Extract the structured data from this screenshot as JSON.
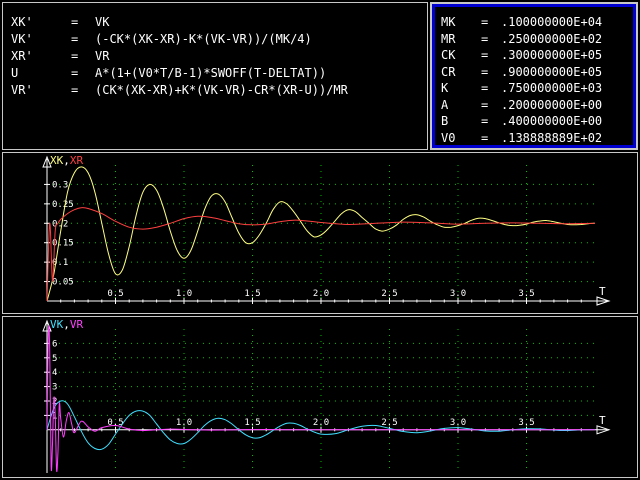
{
  "equations": [
    {
      "lhs": "XK'",
      "sep": "=",
      "rhs": "VK"
    },
    {
      "lhs": "VK'",
      "sep": "=",
      "rhs": "(-CK*(XK-XR)-K*(VK-VR))/(MK/4)"
    },
    {
      "lhs": "XR'",
      "sep": "=",
      "rhs": "VR"
    },
    {
      "lhs": "U",
      "sep": "=",
      "rhs": "A*(1+(V0*T/B-1)*SWOFF(T-DELTAT))"
    },
    {
      "lhs": "VR'",
      "sep": "=",
      "rhs": "(CK*(XK-XR)+K*(VK-VR)-CR*(XR-U))/MR"
    }
  ],
  "parameters": [
    {
      "name": "MK",
      "sep": "=",
      "value": ".100000000E+04"
    },
    {
      "name": "MR",
      "sep": "=",
      "value": ".250000000E+02"
    },
    {
      "name": "CK",
      "sep": "=",
      "value": ".300000000E+05"
    },
    {
      "name": "CR",
      "sep": "=",
      "value": ".900000000E+05"
    },
    {
      "name": "K",
      "sep": "=",
      "value": ".750000000E+03"
    },
    {
      "name": "A",
      "sep": "=",
      "value": ".200000000E+00"
    },
    {
      "name": "B",
      "sep": "=",
      "value": ".400000000E+00"
    },
    {
      "name": "V0",
      "sep": "=",
      "value": ".138888889E+02"
    }
  ],
  "colors": {
    "background": "#000000",
    "border": "#c8c8c8",
    "params_frame": "#0000d0",
    "axes": "#ffffff",
    "grid": "#00c000",
    "xk": "#ffff80",
    "xr": "#ff4040",
    "vk": "#40e0ff",
    "vr": "#ff40ff"
  },
  "chart_data": [
    {
      "type": "line",
      "legend_prefix": "XK",
      "legend_sep": ",",
      "legend_second": "XR",
      "xlabel": "T",
      "xlim": [
        0,
        4.0
      ],
      "ylim": [
        0,
        0.35
      ],
      "x_ticks": [
        "0.5",
        "1.0",
        "1.5",
        "2.0",
        "2.5",
        "3.0",
        "3.5"
      ],
      "x_tick_values": [
        0.5,
        1.0,
        1.5,
        2.0,
        2.5,
        3.0,
        3.5
      ],
      "y_ticks": [
        "0.05",
        "0.1",
        "0.15",
        "0.2",
        "0.25",
        "0.3"
      ],
      "y_tick_values": [
        0.05,
        0.1,
        0.15,
        0.2,
        0.25,
        0.3
      ],
      "series": [
        {
          "name": "XK",
          "color": "#ffff80",
          "x": [
            0,
            0.05,
            0.1,
            0.15,
            0.2,
            0.25,
            0.3,
            0.35,
            0.4,
            0.45,
            0.5,
            0.55,
            0.6,
            0.65,
            0.7,
            0.75,
            0.8,
            0.85,
            0.9,
            0.95,
            1.0,
            1.05,
            1.1,
            1.15,
            1.2,
            1.25,
            1.3,
            1.35,
            1.4,
            1.45,
            1.5,
            1.55,
            1.6,
            1.65,
            1.7,
            1.75,
            1.8,
            1.85,
            1.9,
            1.95,
            2.0,
            2.05,
            2.1,
            2.15,
            2.2,
            2.25,
            2.3,
            2.35,
            2.4,
            2.45,
            2.5,
            2.55,
            2.6,
            2.65,
            2.7,
            2.75,
            2.8,
            2.85,
            2.9,
            2.95,
            3.0,
            3.05,
            3.1,
            3.15,
            3.2,
            3.25,
            3.3,
            3.35,
            3.4,
            3.45,
            3.5,
            3.55,
            3.6,
            3.65,
            3.7,
            3.75,
            3.8,
            3.85,
            3.9,
            3.95,
            4.0
          ],
          "y": [
            0,
            0.07,
            0.18,
            0.28,
            0.33,
            0.345,
            0.33,
            0.28,
            0.2,
            0.12,
            0.07,
            0.08,
            0.14,
            0.22,
            0.28,
            0.3,
            0.285,
            0.24,
            0.18,
            0.13,
            0.11,
            0.13,
            0.18,
            0.235,
            0.27,
            0.275,
            0.255,
            0.215,
            0.175,
            0.15,
            0.15,
            0.17,
            0.2,
            0.235,
            0.255,
            0.25,
            0.23,
            0.205,
            0.18,
            0.165,
            0.17,
            0.185,
            0.205,
            0.225,
            0.235,
            0.23,
            0.215,
            0.2,
            0.185,
            0.18,
            0.185,
            0.195,
            0.21,
            0.22,
            0.222,
            0.216,
            0.205,
            0.196,
            0.19,
            0.19,
            0.194,
            0.2,
            0.208,
            0.213,
            0.212,
            0.207,
            0.201,
            0.196,
            0.194,
            0.195,
            0.198,
            0.203,
            0.206,
            0.207,
            0.204,
            0.2,
            0.197,
            0.196,
            0.197,
            0.199,
            0.2
          ]
        },
        {
          "name": "XR",
          "color": "#ff4040",
          "x": [
            0,
            0.02,
            0.04,
            0.06,
            0.08,
            0.1,
            0.15,
            0.2,
            0.25,
            0.3,
            0.4,
            0.5,
            0.6,
            0.7,
            0.8,
            0.9,
            1.0,
            1.1,
            1.2,
            1.3,
            1.4,
            1.5,
            1.6,
            1.7,
            1.8,
            1.9,
            2.0,
            2.2,
            2.4,
            2.6,
            2.8,
            3.0,
            3.2,
            3.4,
            3.6,
            3.8,
            4.0
          ],
          "y": [
            0,
            0.2,
            0.05,
            0.18,
            0.2,
            0.21,
            0.225,
            0.235,
            0.24,
            0.238,
            0.225,
            0.205,
            0.19,
            0.185,
            0.19,
            0.2,
            0.212,
            0.218,
            0.215,
            0.207,
            0.199,
            0.196,
            0.198,
            0.204,
            0.208,
            0.206,
            0.202,
            0.197,
            0.2,
            0.203,
            0.201,
            0.198,
            0.2,
            0.201,
            0.2,
            0.199,
            0.2
          ]
        }
      ]
    },
    {
      "type": "line",
      "legend_prefix": "VK",
      "legend_sep": ",",
      "legend_second": "VR",
      "xlabel": "T",
      "xlim": [
        0,
        4.0
      ],
      "ylim": [
        -3,
        7
      ],
      "x_ticks": [
        "0.5",
        "1.0",
        "1.5",
        "2.0",
        "2.5",
        "3.0",
        "3.5"
      ],
      "x_tick_values": [
        0.5,
        1.0,
        1.5,
        2.0,
        2.5,
        3.0,
        3.5
      ],
      "y_ticks": [
        "1",
        "2",
        "3",
        "4",
        "5",
        "6"
      ],
      "y_tick_values": [
        1,
        2,
        3,
        4,
        5,
        6
      ],
      "series": [
        {
          "name": "VK",
          "color": "#40e0ff",
          "x": [
            0,
            0.05,
            0.1,
            0.15,
            0.2,
            0.25,
            0.3,
            0.35,
            0.4,
            0.45,
            0.5,
            0.55,
            0.6,
            0.65,
            0.7,
            0.75,
            0.8,
            0.85,
            0.9,
            0.95,
            1.0,
            1.05,
            1.1,
            1.15,
            1.2,
            1.25,
            1.3,
            1.35,
            1.4,
            1.45,
            1.5,
            1.55,
            1.6,
            1.65,
            1.7,
            1.75,
            1.8,
            1.85,
            1.9,
            1.95,
            2.0,
            2.1,
            2.2,
            2.3,
            2.4,
            2.5,
            2.6,
            2.7,
            2.8,
            2.9,
            3.0,
            3.1,
            3.2,
            3.3,
            3.4,
            3.5,
            3.6,
            3.7,
            3.8,
            3.9,
            4.0
          ],
          "y": [
            0,
            1.5,
            2.0,
            1.8,
            0.9,
            -0.1,
            -0.9,
            -1.3,
            -1.35,
            -1.0,
            -0.3,
            0.4,
            1.0,
            1.3,
            1.3,
            1.0,
            0.4,
            -0.2,
            -0.7,
            -0.95,
            -0.95,
            -0.65,
            -0.2,
            0.3,
            0.65,
            0.8,
            0.7,
            0.4,
            0.0,
            -0.35,
            -0.55,
            -0.55,
            -0.35,
            -0.05,
            0.25,
            0.45,
            0.45,
            0.3,
            0.05,
            -0.15,
            -0.3,
            -0.28,
            0.0,
            0.25,
            0.3,
            0.1,
            -0.12,
            -0.2,
            -0.08,
            0.1,
            0.15,
            0.05,
            -0.08,
            -0.1,
            0.0,
            0.07,
            0.06,
            -0.02,
            -0.05,
            0.0,
            0.02
          ]
        },
        {
          "name": "VR",
          "color": "#ff40ff",
          "x": [
            0,
            0.01,
            0.02,
            0.03,
            0.04,
            0.05,
            0.06,
            0.07,
            0.08,
            0.09,
            0.1,
            0.12,
            0.14,
            0.16,
            0.18,
            0.2,
            0.25,
            0.3,
            0.35,
            0.4,
            0.5,
            0.6,
            0.7,
            0.8,
            0.9,
            1.0,
            1.2,
            1.4,
            1.6,
            1.8,
            2.0,
            2.5,
            3.0,
            3.5,
            4.0
          ],
          "y": [
            0,
            6.8,
            5.5,
            -2.5,
            -1.0,
            2.2,
            1.0,
            -2.8,
            -1.5,
            1.8,
            0.8,
            -0.5,
            0.6,
            1.2,
            0.4,
            -0.2,
            0.6,
            0.2,
            -0.1,
            0.15,
            0.3,
            0.05,
            -0.05,
            0.0,
            0.05,
            0.02,
            -0.02,
            0.0,
            0.02,
            0.0,
            0.0,
            0.0,
            0.0,
            0.0,
            0.0
          ]
        }
      ]
    }
  ]
}
